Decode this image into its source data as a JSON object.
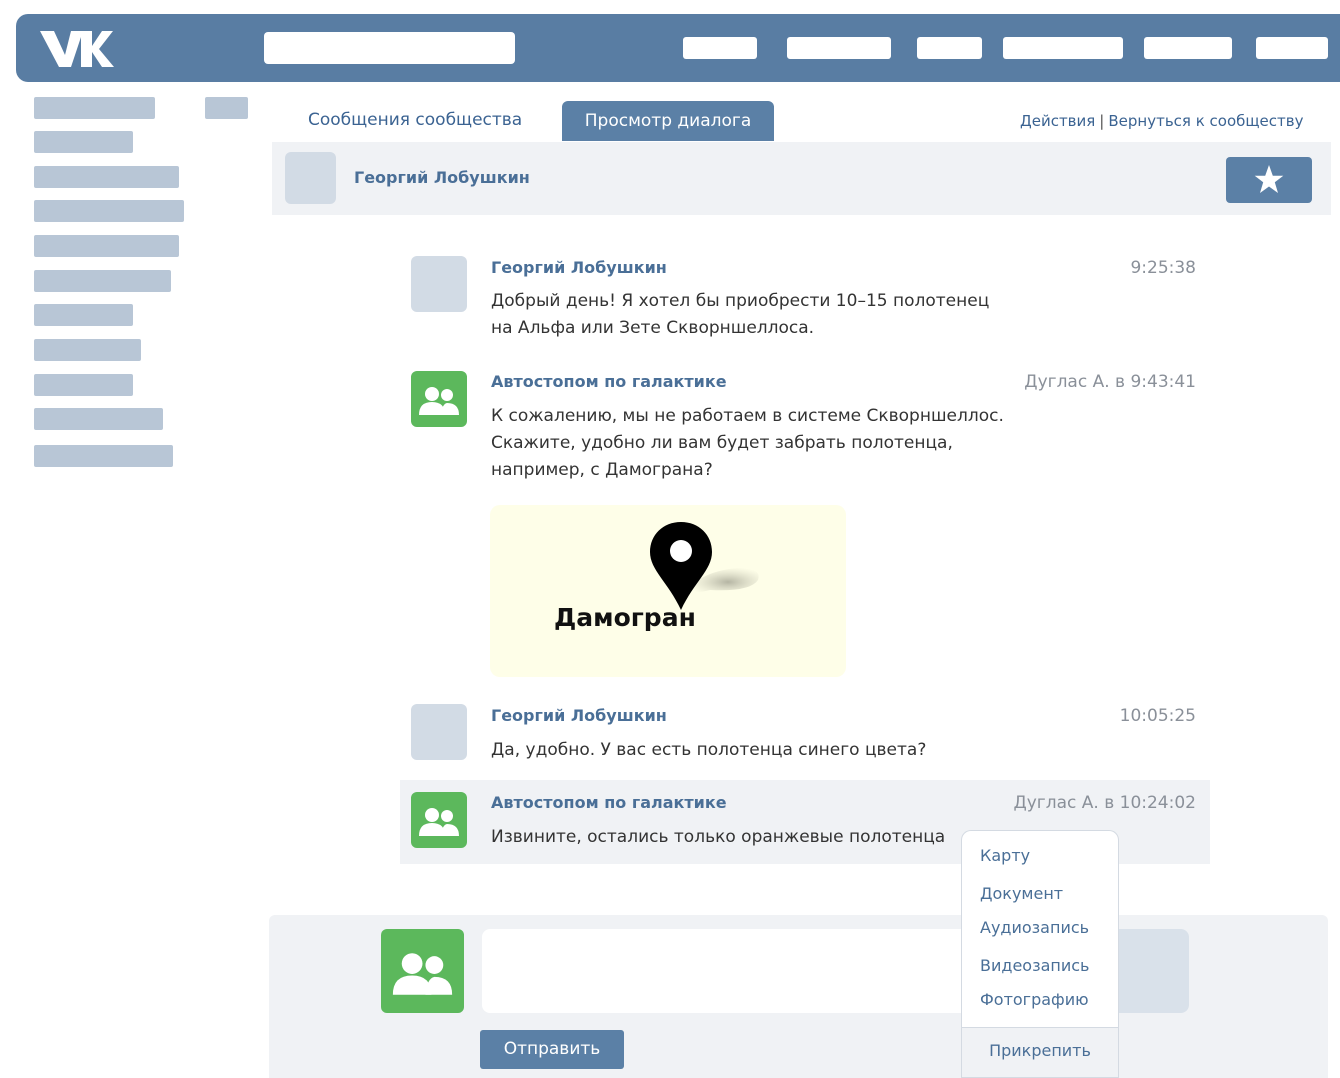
{
  "tabs": {
    "messages": "Сообщения сообщества",
    "view_dialog": "Просмотр диалога"
  },
  "top_links": {
    "actions": "Действия",
    "separator": "|",
    "back": "Вернуться к сообществу"
  },
  "dialog": {
    "contact_name": "Георгий Лобушкин"
  },
  "messages": [
    {
      "sender": "Георгий Лобушкин",
      "time": "9:25:38",
      "lines": [
        "Добрый день! Я хотел бы приобрести 10–15 полотенец",
        "на Альфа или Зете Скворншеллоса."
      ]
    },
    {
      "sender": "Автостопом по галактике",
      "time": "Дуглас А. в 9:43:41",
      "lines": [
        "К сожалению, мы не работаем в системе Скворншеллос.",
        "Скажите, удобно ли вам будет забрать полотенца,",
        "например, с Дамограна?"
      ],
      "map_label": "Дамогран"
    },
    {
      "sender": "Георгий Лобушкин",
      "time": "10:05:25",
      "lines": [
        "Да, удобно. У вас есть полотенца синего цвета?"
      ]
    },
    {
      "sender": "Автостопом по галактике",
      "time": "Дуглас А. в 10:24:02",
      "lines": [
        "Извините, остались только оранжевые полотенца"
      ]
    }
  ],
  "attach_menu": {
    "items": [
      "Карту",
      "Документ",
      "Аудиозапись",
      "Видеозапись",
      "Фотографию"
    ],
    "button": "Прикрепить"
  },
  "compose": {
    "send_label": "Отправить"
  },
  "icons": {
    "logo": "vk-logo-icon",
    "star": "star-icon",
    "community": "community-icon",
    "map_pin": "map-pin-icon"
  },
  "colors": {
    "topbar": "#597da3",
    "accent": "#5b80a6",
    "link": "#4a6f97",
    "community_avatar": "#5cb85c",
    "panel": "#f0f2f5"
  }
}
